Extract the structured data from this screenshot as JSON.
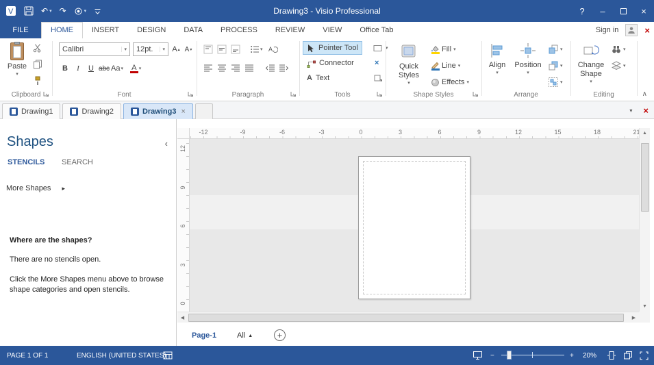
{
  "colors": {
    "accent": "#2B579A",
    "selection_bg": "#CDE6F7",
    "selection_border": "#92C0E6",
    "close_red": "#C00000",
    "fill_yellow": "#FFD500",
    "line_blue": "#2E75B6"
  },
  "icons": {
    "caret": "▾",
    "chevron_up": "∧",
    "more": "▸",
    "collapse_left": "‹",
    "close": "×",
    "minimize": "–",
    "help": "?",
    "undo": "↶",
    "redo": "↷",
    "zoom_out": "−",
    "zoom_in": "+",
    "up": "▲",
    "down": "▼",
    "left": "◀",
    "right": "▶",
    "all_up": "▲",
    "add": "+",
    "grow": "▴",
    "shrink": "▾"
  },
  "titlebar": {
    "title": "Drawing3 - Visio Professional"
  },
  "tabs": {
    "file": "FILE",
    "items": [
      "HOME",
      "INSERT",
      "DESIGN",
      "DATA",
      "PROCESS",
      "REVIEW",
      "VIEW",
      "Office Tab"
    ],
    "active_index": 0,
    "sign_in": "Sign in"
  },
  "ribbon": {
    "clipboard": {
      "label": "Clipboard",
      "paste": "Paste"
    },
    "font": {
      "label": "Font",
      "family": "Calibri",
      "size": "12pt.",
      "bold": "B",
      "italic": "I",
      "underline": "U",
      "strike": "abc",
      "case": "Aa",
      "color": "A",
      "grow": "A",
      "shrink": "A"
    },
    "paragraph": {
      "label": "Paragraph"
    },
    "tools": {
      "label": "Tools",
      "pointer": "Pointer Tool",
      "connector": "Connector",
      "text": "Text",
      "text_glyph": "A"
    },
    "shape_styles": {
      "label": "Shape Styles",
      "quick_styles": "Quick\nStyles",
      "fill": "Fill",
      "line": "Line",
      "effects": "Effects"
    },
    "arrange": {
      "label": "Arrange",
      "align": "Align",
      "position": "Position"
    },
    "editing": {
      "label": "Editing",
      "change_shape": "Change\nShape"
    }
  },
  "doc_tabs": {
    "tabs": [
      {
        "label": "Drawing1",
        "active": false
      },
      {
        "label": "Drawing2",
        "active": false
      },
      {
        "label": "Drawing3",
        "active": true
      }
    ]
  },
  "shapes_panel": {
    "title": "Shapes",
    "stencils": "STENCILS",
    "search": "SEARCH",
    "more_shapes": "More Shapes",
    "empty_heading": "Where are the shapes?",
    "empty_line1": "There are no stencils open.",
    "empty_line2": "Click the More Shapes menu above to browse shape categories and open stencils."
  },
  "rulers": {
    "horizontal": [
      "-12",
      "-9",
      "-6",
      "-3",
      "0",
      "3",
      "6",
      "9",
      "12",
      "15",
      "18",
      "21"
    ],
    "vertical": [
      "12",
      "9",
      "6",
      "3",
      "0"
    ]
  },
  "page_bar": {
    "page": "Page-1",
    "all": "All"
  },
  "status": {
    "page_info": "PAGE 1 OF 1",
    "language": "ENGLISH (UNITED STATES)",
    "zoom_level": "20%"
  }
}
